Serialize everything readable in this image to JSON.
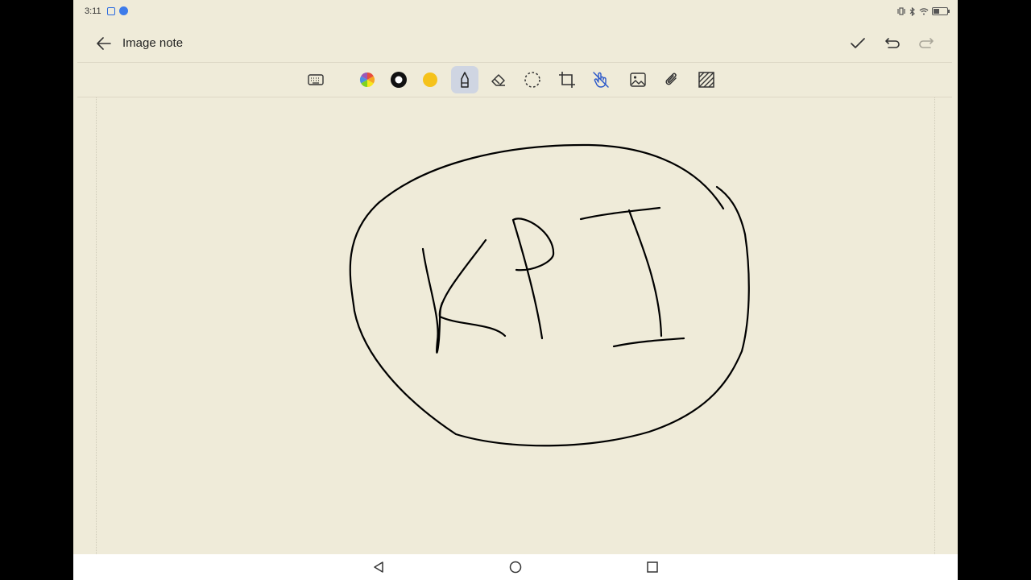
{
  "status_bar": {
    "time": "3:11"
  },
  "header": {
    "title": "Image note"
  },
  "toolbar": {
    "tools": [
      "keyboard",
      "color-wheel",
      "stroke-size",
      "color-yellow",
      "pen",
      "eraser",
      "lasso",
      "crop",
      "finger-draw",
      "image",
      "attachment",
      "background-pattern"
    ],
    "active_tool": "pen",
    "selected_color": "#f5c21b",
    "accent": "#2b58c9"
  },
  "colors": {
    "background": "#efebd9",
    "ink": "#000000"
  }
}
